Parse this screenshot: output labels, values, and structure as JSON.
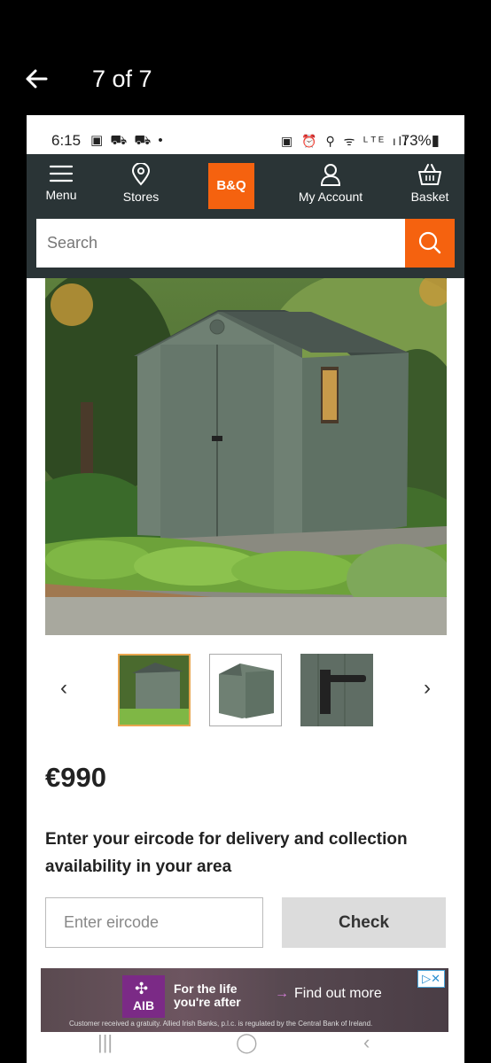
{
  "viewer": {
    "counter": "7 of 7",
    "back_icon": "arrow-left-icon"
  },
  "status_bar": {
    "time": "6:15",
    "notification_icons": "▣ ⛟ ⛟ •",
    "system_icons": "▣ ⏰ ⚲ ᯤ ᴸᵀᴱ ıll",
    "battery": "73%▮"
  },
  "app_nav": {
    "menu_label": "Menu",
    "stores_label": "Stores",
    "logo_text": "B&Q",
    "account_label": "My Account",
    "basket_label": "Basket"
  },
  "search": {
    "placeholder": "Search"
  },
  "product": {
    "price": "€990",
    "eircode_prompt": "Enter your eircode for delivery and collection availability in your area",
    "eircode_placeholder": "Enter eircode",
    "check_label": "Check"
  },
  "gallery": {
    "prev_label": "‹",
    "next_label": "›"
  },
  "ad": {
    "brand": "AIB",
    "tagline": "For the life you're after",
    "cta": "Find out more",
    "cta_arrow": "→",
    "disclaimer": "Customer received a gratuity. Allied Irish Banks, p.l.c. is regulated by the Central Bank of Ireland.",
    "choices_label": "▷✕"
  },
  "system_nav": {
    "recents": "|||",
    "home": "◯",
    "back": "‹"
  },
  "colors": {
    "brand_orange": "#f5620f",
    "nav_dark": "#2a3436",
    "ad_purple": "#7b2a86"
  }
}
